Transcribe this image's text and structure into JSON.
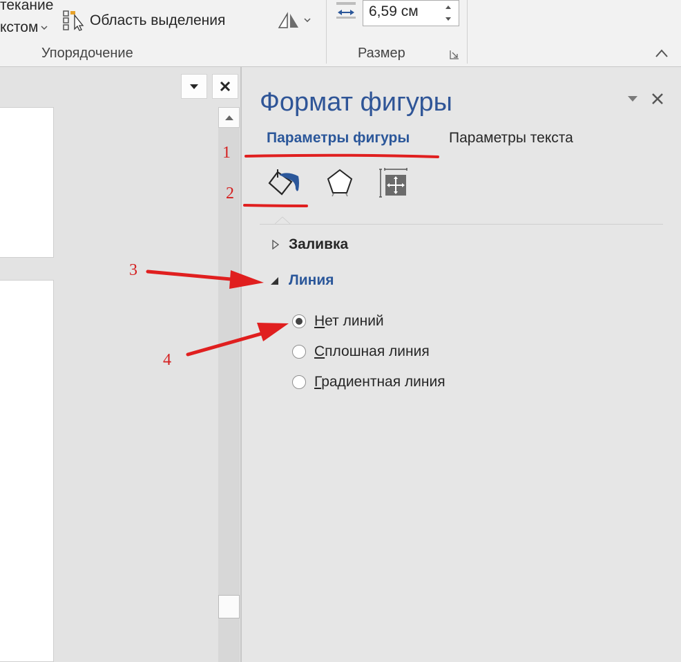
{
  "ribbon": {
    "wrap_text_line1": "текание",
    "wrap_text_line2": "кстом",
    "selection_pane_label": "Область выделения",
    "arrange_group": "Упорядочение",
    "size_group": "Размер",
    "size_value": "6,59 см"
  },
  "format_pane": {
    "title": "Формат фигуры",
    "tabs": {
      "shape_options": "Параметры фигуры",
      "text_options": "Параметры текста"
    },
    "sections": {
      "fill": "Заливка",
      "line": "Линия"
    },
    "line_options": [
      {
        "label_first": "Н",
        "label_rest": "ет линий",
        "selected": true
      },
      {
        "label_first": "С",
        "label_rest": "плошная линия",
        "selected": false
      },
      {
        "label_first": "Г",
        "label_rest": "радиентная линия",
        "selected": false
      }
    ],
    "colors": {
      "title": "#2f5597",
      "accent": "#2b579a",
      "annotation": "#e01f1f"
    }
  },
  "annotations": [
    "1",
    "2",
    "3",
    "4"
  ],
  "icons": [
    "selection-pane-icon",
    "rotate-icon",
    "height-icon",
    "spin-up-icon",
    "spin-down-icon",
    "dialog-launcher-icon",
    "collapse-ribbon-icon",
    "dropdown-icon",
    "close-icon",
    "fill-line-icon",
    "effects-icon",
    "layout-properties-icon",
    "expand-triangle-icon",
    "collapse-triangle-icon"
  ]
}
